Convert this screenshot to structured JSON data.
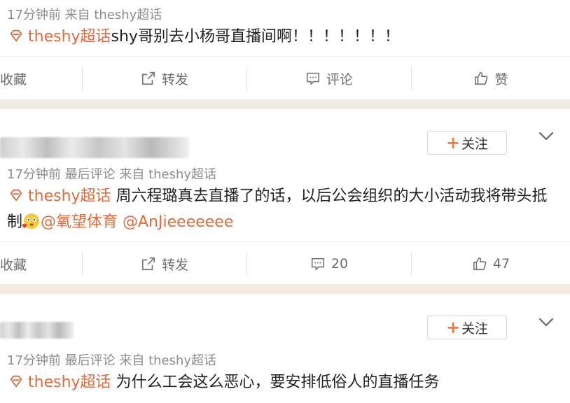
{
  "post1": {
    "meta": "17分钟前 来自 theshy超话",
    "topic": "theshy超话",
    "body": "shy哥别去小杨哥直播间啊！！！！！！！"
  },
  "actions1": {
    "collect": "收藏",
    "repost": "转发",
    "comment": "评论",
    "like": "赞"
  },
  "post2": {
    "follow": "关注",
    "meta": "17分钟前 最后评论 来自 theshy超话",
    "topic": "theshy超话",
    "body_line1": "周六程璐真去直播了的话，以后公会组织的大小活动我将带头抵",
    "body_line2_prefix": "制",
    "mention1": "@氧望体育",
    "mention2": "@AnJieeeeeee"
  },
  "actions2": {
    "collect": "收藏",
    "repost": "转发",
    "comment_count": "20",
    "like_count": "47"
  },
  "post3": {
    "follow": "关注",
    "meta": "17分钟前 最后评论 来自 theshy超话",
    "topic": "theshy超话",
    "body": "为什么工会这么恶心，要安排低俗人的直播任务"
  },
  "colors": {
    "accent": "#e06c3c",
    "follow_plus": "#f07a3c",
    "gap": "#f1ebe4"
  },
  "icons": [
    "supertopic-tag-icon",
    "share-icon",
    "comment-icon",
    "like-icon",
    "chevron-down-icon",
    "plus-icon",
    "emoji-icon"
  ]
}
